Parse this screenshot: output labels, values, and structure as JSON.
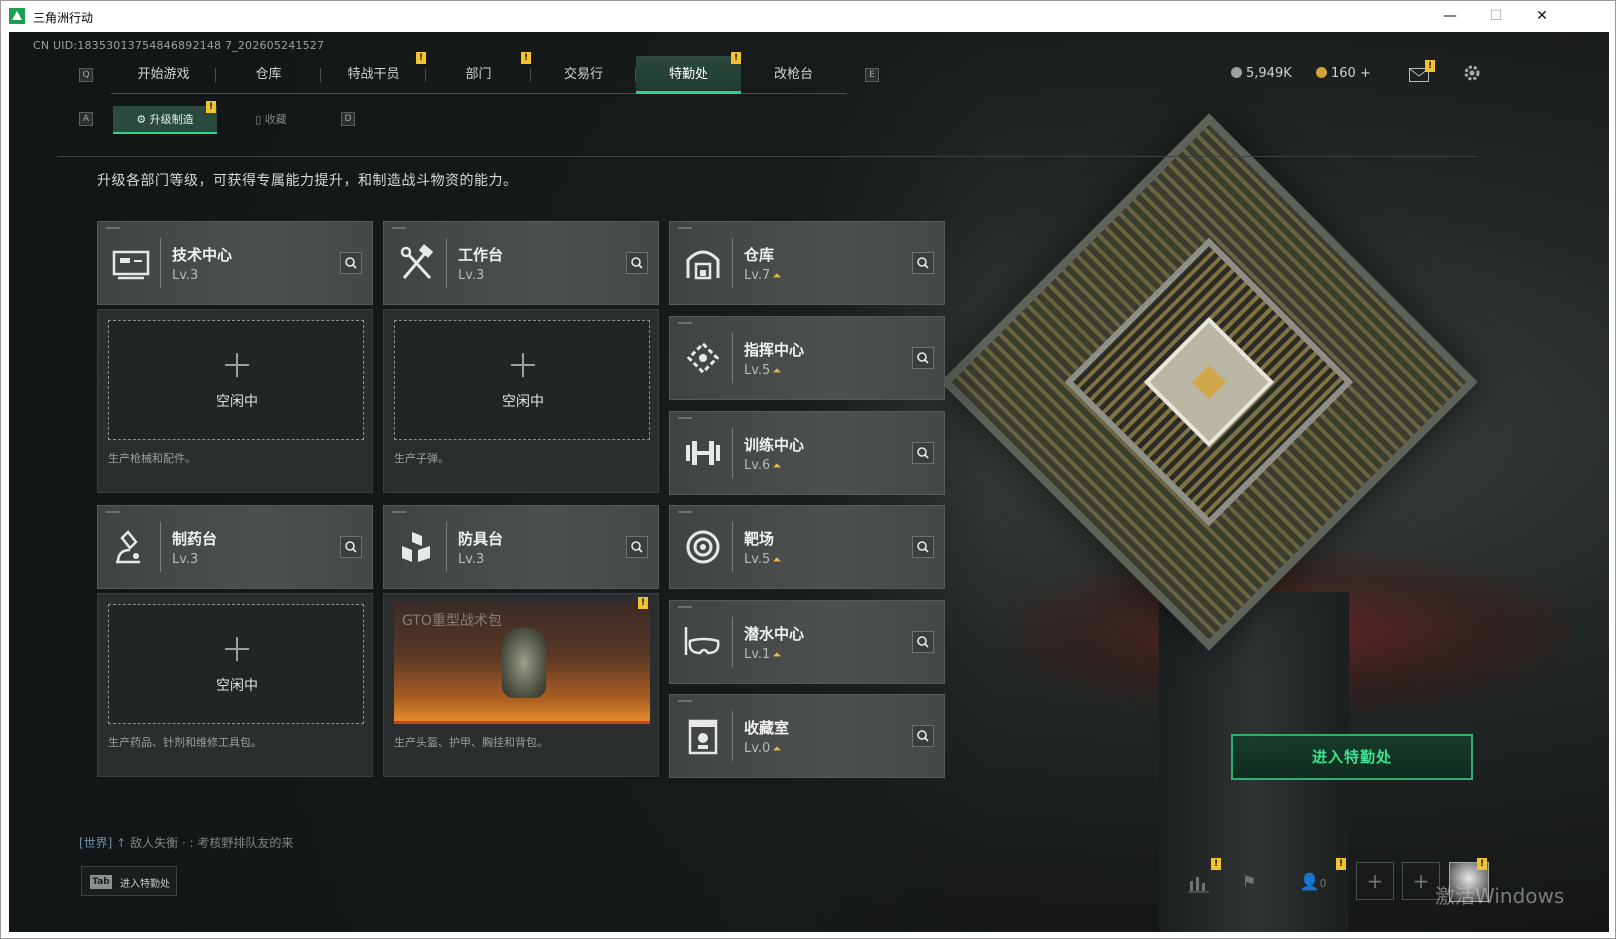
{
  "window": {
    "title": "三角洲行动",
    "controls": {
      "minimize": "—",
      "maximize": "☐",
      "close": "✕"
    }
  },
  "uid": "CN UID:18353013754846892148 7_202605241527",
  "keys": {
    "left": "Q",
    "right": "E",
    "sub_left": "A",
    "sub_right": "D"
  },
  "nav": {
    "tabs": [
      {
        "label": "开始游戏",
        "badge": ""
      },
      {
        "label": "仓库",
        "badge": ""
      },
      {
        "label": "特战干员",
        "badge": "!"
      },
      {
        "label": "部门",
        "badge": "!"
      },
      {
        "label": "交易行",
        "badge": ""
      },
      {
        "label": "特勤处",
        "badge": "!"
      },
      {
        "label": "改枪台",
        "badge": ""
      }
    ],
    "active": "特勤处"
  },
  "resources": {
    "currency1": "5,949K",
    "currency2": "160",
    "add": "+",
    "mail_badge": "!"
  },
  "subnav": {
    "tabs": [
      {
        "label": "升级制造",
        "badge": "!"
      },
      {
        "label": "收藏",
        "badge": ""
      }
    ]
  },
  "description": "升级各部门等级，可获得专属能力提升，和制造战斗物资的能力。",
  "departments": {
    "tech": {
      "name": "技术中心",
      "level": "Lv.3"
    },
    "workbench": {
      "name": "工作台",
      "level": "Lv.3"
    },
    "pharmacy": {
      "name": "制药台",
      "level": "Lv.3"
    },
    "armor": {
      "name": "防具台",
      "level": "Lv.3"
    },
    "warehouse": {
      "name": "仓库",
      "level": "Lv.7"
    },
    "command": {
      "name": "指挥中心",
      "level": "Lv.5"
    },
    "training": {
      "name": "训练中心",
      "level": "Lv.6"
    },
    "range": {
      "name": "靶场",
      "level": "Lv.5"
    },
    "diving": {
      "name": "潜水中心",
      "level": "Lv.1"
    },
    "collection": {
      "name": "收藏室",
      "level": "Lv.0"
    }
  },
  "slots": {
    "tech": {
      "status": "空闲中",
      "caption": "生产枪械和配件。"
    },
    "workbench": {
      "status": "空闲中",
      "caption": "生产子弹。"
    },
    "pharmacy": {
      "status": "空闲中",
      "caption": "生产药品、针剂和维修工具包。"
    },
    "armor": {
      "item": "GTO重型战术包",
      "caption": "生产头盔、护甲、胸挂和背包。",
      "badge": "!"
    }
  },
  "enter_button": "进入特勤处",
  "chat": {
    "channel": "[世界]",
    "text": "↑ 敌人失衡 · : 考核野排队友的来"
  },
  "tab_hint": {
    "key": "Tab",
    "text": "进入特勤处"
  },
  "bottom": {
    "friends_count": "0",
    "plus": "+"
  },
  "watermark": "激活Windows",
  "colors": {
    "accent": "#2fd48a",
    "badge": "#f2c230",
    "upgrade": "#e8b94a",
    "enter": "#3be28f"
  }
}
